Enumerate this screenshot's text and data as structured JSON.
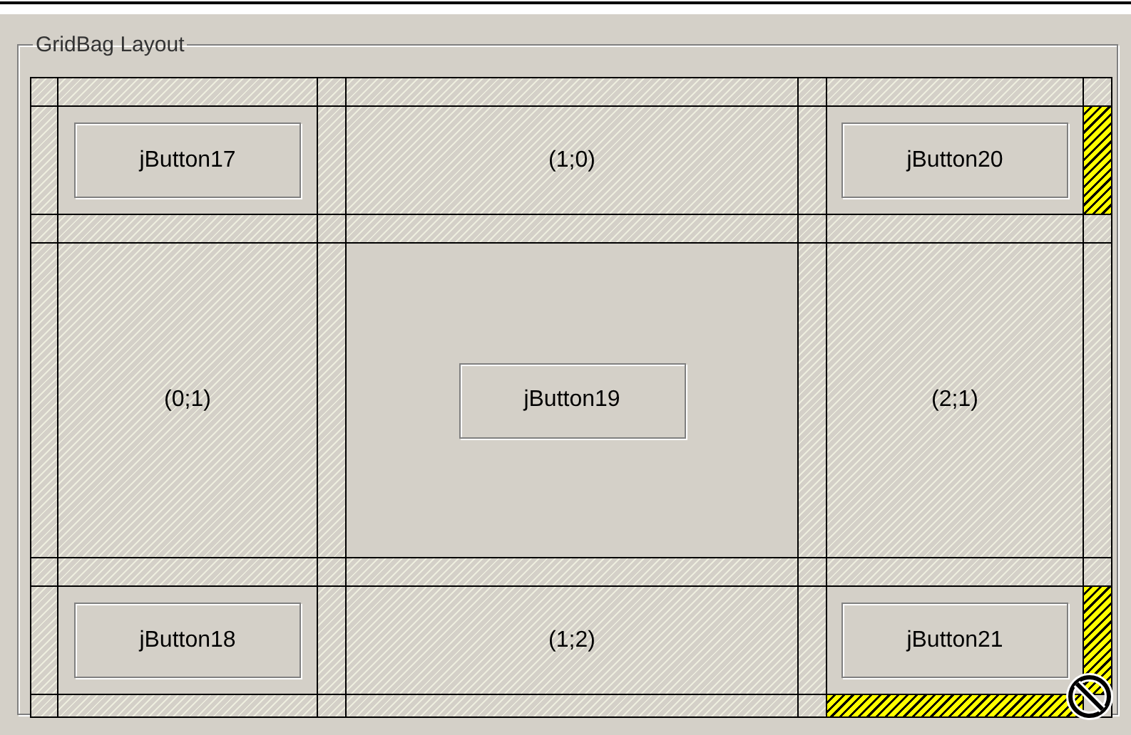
{
  "panel": {
    "title": "GridBag Layout"
  },
  "cells": [
    {
      "kind": "button",
      "text": "jButton17",
      "marked_right": false,
      "marked_bottom": false
    },
    {
      "kind": "placeholder",
      "text": "(1;0)",
      "marked_right": false,
      "marked_bottom": false
    },
    {
      "kind": "button",
      "text": "jButton20",
      "marked_right": true,
      "marked_bottom": false
    },
    {
      "kind": "placeholder",
      "text": "(0;1)",
      "marked_right": false,
      "marked_bottom": false
    },
    {
      "kind": "button",
      "text": "jButton19",
      "marked_right": false,
      "marked_bottom": false
    },
    {
      "kind": "placeholder",
      "text": "(2;1)",
      "marked_right": false,
      "marked_bottom": false
    },
    {
      "kind": "button",
      "text": "jButton18",
      "marked_right": false,
      "marked_bottom": false
    },
    {
      "kind": "placeholder",
      "text": "(1;2)",
      "marked_right": false,
      "marked_bottom": false
    },
    {
      "kind": "button",
      "text": "jButton21",
      "marked_right": true,
      "marked_bottom": true
    }
  ]
}
